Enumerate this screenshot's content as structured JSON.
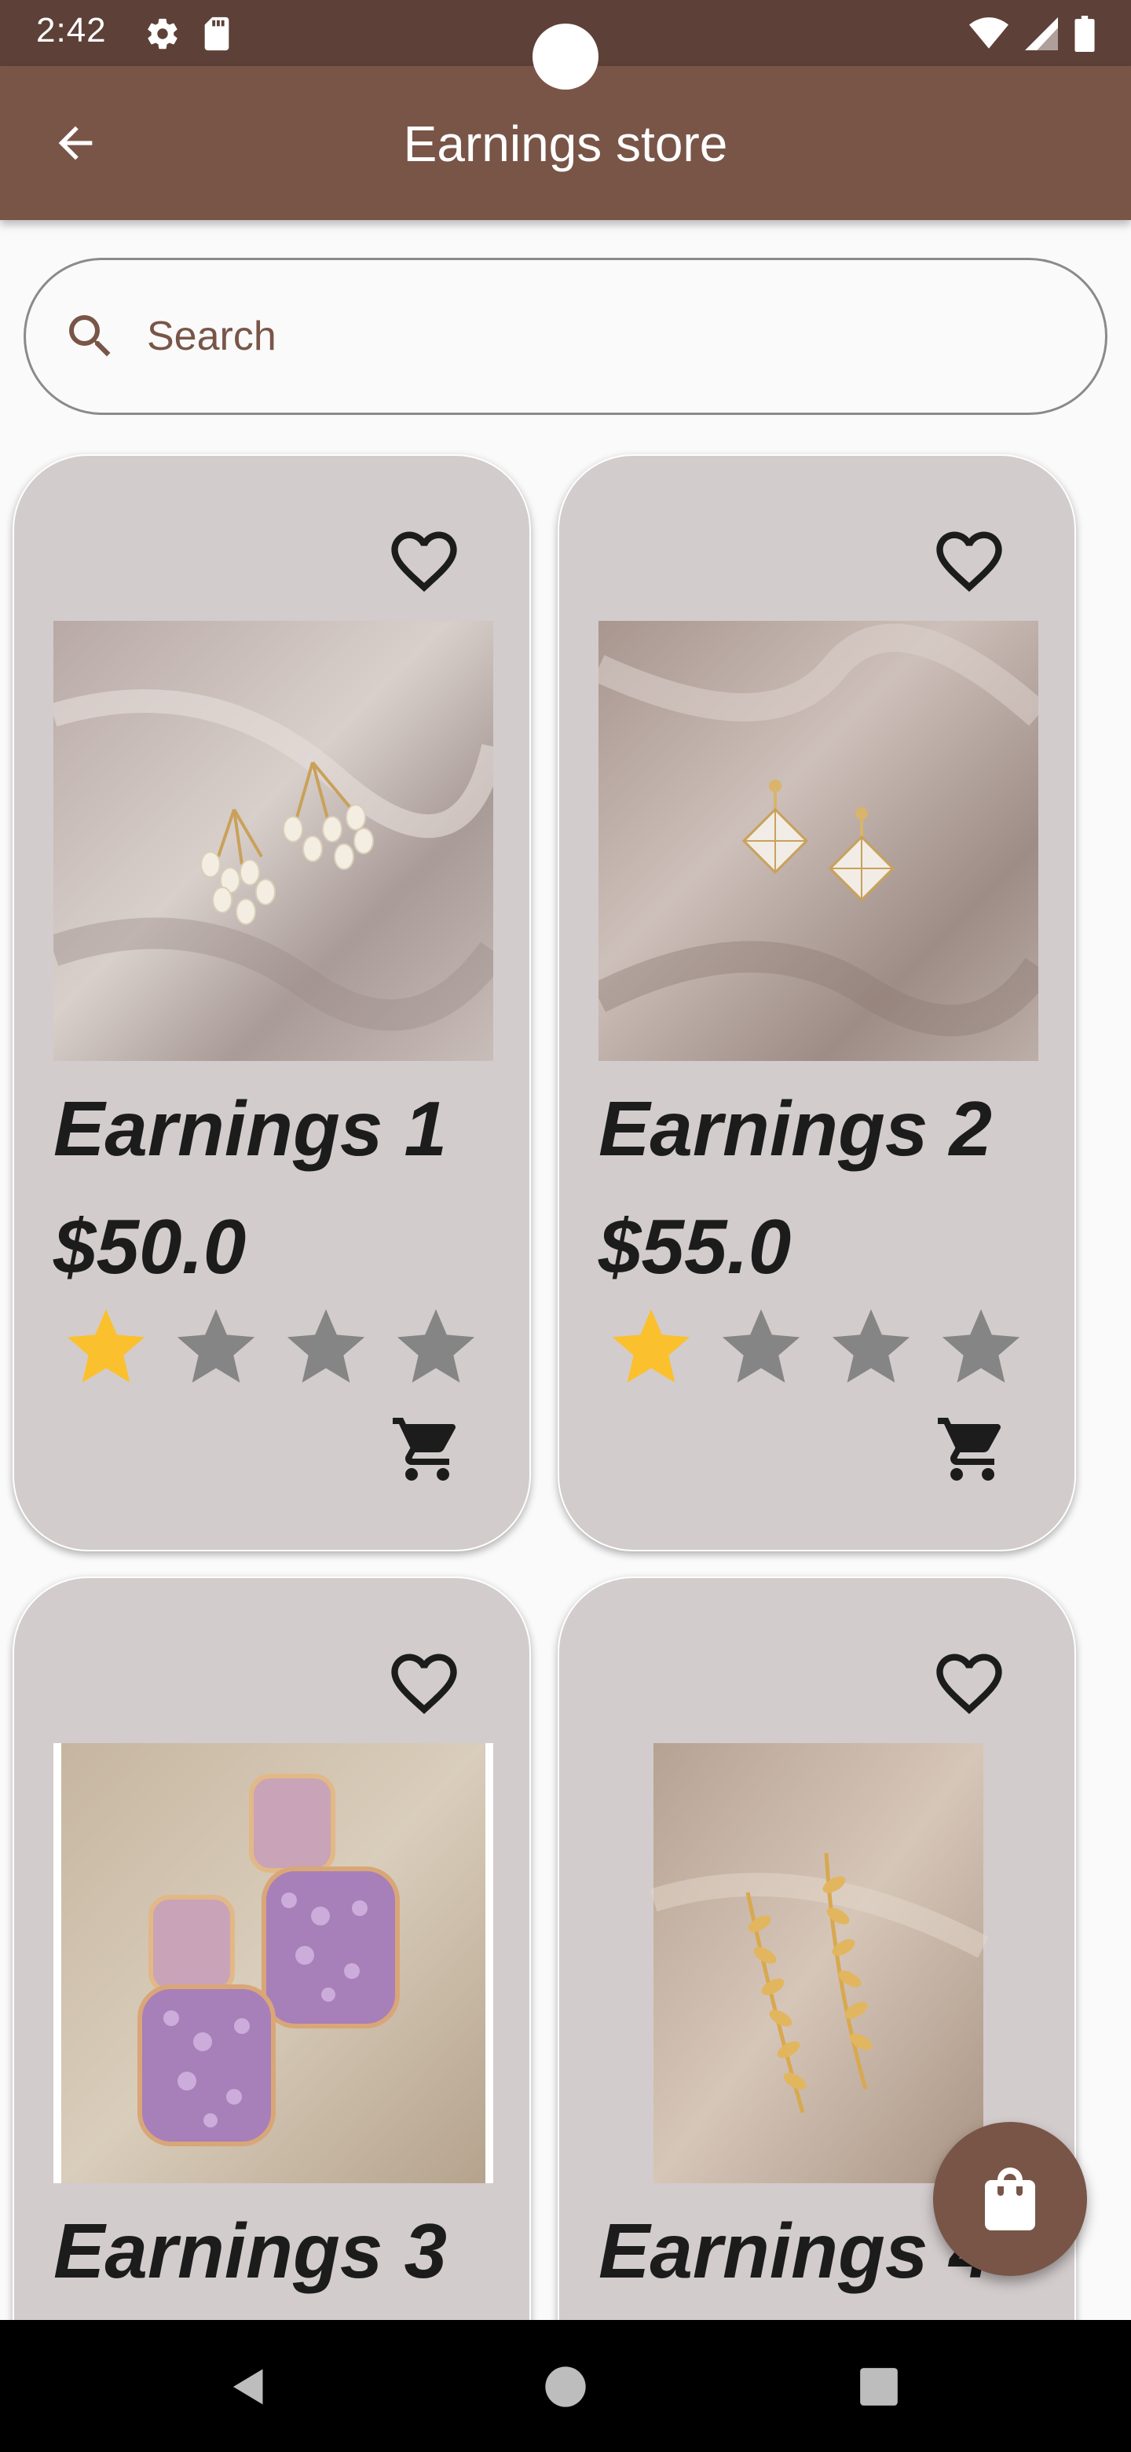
{
  "status_bar": {
    "time": "2:42"
  },
  "app_bar": {
    "title": "Earnings store"
  },
  "search": {
    "placeholder": "Search"
  },
  "colors": {
    "status_bar": "#5d4037",
    "app_bar": "#795548",
    "card_bg": "#d3cccc",
    "star_filled": "#fbc02d",
    "star_empty": "#858585"
  },
  "products": [
    {
      "name": "Earnings 1",
      "price": "$50.0",
      "rating": 1,
      "max_rating": 4,
      "image": "pearl-cluster-earrings"
    },
    {
      "name": "Earnings 2",
      "price": "$55.0",
      "rating": 1,
      "max_rating": 4,
      "image": "crystal-flower-earrings"
    },
    {
      "name": "Earnings 3",
      "image": "purple-square-earrings"
    },
    {
      "name": "Earnings 4",
      "image": "gold-leaf-earrings"
    }
  ]
}
